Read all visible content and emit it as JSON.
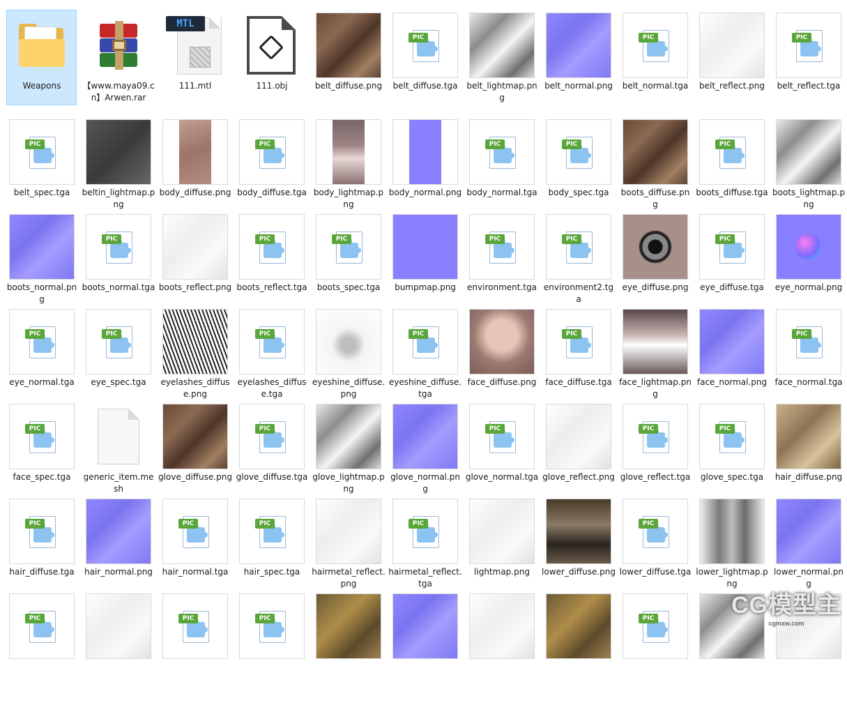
{
  "watermark": {
    "brand": "CG模型主",
    "url": "cgmxw.com"
  },
  "items": [
    {
      "name": "Weapons",
      "icon": "folder",
      "selected": true
    },
    {
      "name": "【www.maya09.cn】Arwen.rar",
      "icon": "rar"
    },
    {
      "name": "111.mtl",
      "icon": "mtl",
      "badge": "MTL"
    },
    {
      "name": "111.obj",
      "icon": "obj"
    },
    {
      "name": "belt_diffuse.png",
      "icon": "img",
      "style": "diffuse"
    },
    {
      "name": "belt_diffuse.tga",
      "icon": "pic"
    },
    {
      "name": "belt_lightmap.png",
      "icon": "img",
      "style": "gray"
    },
    {
      "name": "belt_normal.png",
      "icon": "img",
      "style": "normal"
    },
    {
      "name": "belt_normal.tga",
      "icon": "pic"
    },
    {
      "name": "belt_reflect.png",
      "icon": "img",
      "style": "white"
    },
    {
      "name": "belt_reflect.tga",
      "icon": "pic"
    },
    {
      "name": "belt_spec.tga",
      "icon": "pic"
    },
    {
      "name": "beltin_lightmap.png",
      "icon": "img",
      "style": "dark"
    },
    {
      "name": "body_diffuse.png",
      "icon": "img",
      "style": "skin",
      "narrow": true
    },
    {
      "name": "body_diffuse.tga",
      "icon": "pic"
    },
    {
      "name": "body_lightmap.png",
      "icon": "img",
      "style": "pinkgray",
      "narrow": true
    },
    {
      "name": "body_normal.png",
      "icon": "img",
      "style": "flat",
      "narrow": true
    },
    {
      "name": "body_normal.tga",
      "icon": "pic"
    },
    {
      "name": "body_spec.tga",
      "icon": "pic"
    },
    {
      "name": "boots_diffuse.png",
      "icon": "img",
      "style": "diffuse"
    },
    {
      "name": "boots_diffuse.tga",
      "icon": "pic"
    },
    {
      "name": "boots_lightmap.png",
      "icon": "img",
      "style": "gray"
    },
    {
      "name": "boots_normal.png",
      "icon": "img",
      "style": "normal"
    },
    {
      "name": "boots_normal.tga",
      "icon": "pic"
    },
    {
      "name": "boots_reflect.png",
      "icon": "img",
      "style": "white"
    },
    {
      "name": "boots_reflect.tga",
      "icon": "pic"
    },
    {
      "name": "boots_spec.tga",
      "icon": "pic"
    },
    {
      "name": "bumpmap.png",
      "icon": "img",
      "style": "flat"
    },
    {
      "name": "environment.tga",
      "icon": "pic"
    },
    {
      "name": "environment2.tga",
      "icon": "pic"
    },
    {
      "name": "eye_diffuse.png",
      "icon": "img",
      "style": "eye"
    },
    {
      "name": "eye_diffuse.tga",
      "icon": "pic"
    },
    {
      "name": "eye_normal.png",
      "icon": "img",
      "style": "sphere"
    },
    {
      "name": "eye_normal.tga",
      "icon": "pic"
    },
    {
      "name": "eye_spec.tga",
      "icon": "pic"
    },
    {
      "name": "eyelashes_diffuse.png",
      "icon": "img",
      "style": "lashes"
    },
    {
      "name": "eyelashes_diffuse.tga",
      "icon": "pic"
    },
    {
      "name": "eyeshine_diffuse.png",
      "icon": "img",
      "style": "blur"
    },
    {
      "name": "eyeshine_diffuse.tga",
      "icon": "pic"
    },
    {
      "name": "face_diffuse.png",
      "icon": "img",
      "style": "face"
    },
    {
      "name": "face_diffuse.tga",
      "icon": "pic"
    },
    {
      "name": "face_lightmap.png",
      "icon": "img",
      "style": "facelm"
    },
    {
      "name": "face_normal.png",
      "icon": "img",
      "style": "normal"
    },
    {
      "name": "face_normal.tga",
      "icon": "pic"
    },
    {
      "name": "face_spec.tga",
      "icon": "pic"
    },
    {
      "name": "generic_item.mesh",
      "icon": "generic"
    },
    {
      "name": "glove_diffuse.png",
      "icon": "img",
      "style": "diffuse"
    },
    {
      "name": "glove_diffuse.tga",
      "icon": "pic"
    },
    {
      "name": "glove_lightmap.png",
      "icon": "img",
      "style": "gray"
    },
    {
      "name": "glove_normal.png",
      "icon": "img",
      "style": "normal"
    },
    {
      "name": "glove_normal.tga",
      "icon": "pic"
    },
    {
      "name": "glove_reflect.png",
      "icon": "img",
      "style": "white"
    },
    {
      "name": "glove_reflect.tga",
      "icon": "pic"
    },
    {
      "name": "glove_spec.tga",
      "icon": "pic"
    },
    {
      "name": "hair_diffuse.png",
      "icon": "img",
      "style": "hair"
    },
    {
      "name": "hair_diffuse.tga",
      "icon": "pic"
    },
    {
      "name": "hair_normal.png",
      "icon": "img",
      "style": "normal"
    },
    {
      "name": "hair_normal.tga",
      "icon": "pic"
    },
    {
      "name": "hair_spec.tga",
      "icon": "pic"
    },
    {
      "name": "hairmetal_reflect.png",
      "icon": "img",
      "style": "white"
    },
    {
      "name": "hairmetal_reflect.tga",
      "icon": "pic"
    },
    {
      "name": "lightmap.png",
      "icon": "img",
      "style": "white"
    },
    {
      "name": "lower_diffuse.png",
      "icon": "img",
      "style": "lower"
    },
    {
      "name": "lower_diffuse.tga",
      "icon": "pic"
    },
    {
      "name": "lower_lightmap.png",
      "icon": "img",
      "style": "lowerlm"
    },
    {
      "name": "lower_normal.png",
      "icon": "img",
      "style": "normal"
    },
    {
      "name": "",
      "icon": "pic"
    },
    {
      "name": "",
      "icon": "img",
      "style": "white"
    },
    {
      "name": "",
      "icon": "pic"
    },
    {
      "name": "",
      "icon": "pic"
    },
    {
      "name": "",
      "icon": "img",
      "style": "brass"
    },
    {
      "name": "",
      "icon": "img",
      "style": "normal"
    },
    {
      "name": "",
      "icon": "img",
      "style": "white"
    },
    {
      "name": "",
      "icon": "img",
      "style": "brass"
    },
    {
      "name": "",
      "icon": "pic"
    },
    {
      "name": "",
      "icon": "img",
      "style": "gray"
    },
    {
      "name": "",
      "icon": "img",
      "style": "white"
    }
  ]
}
